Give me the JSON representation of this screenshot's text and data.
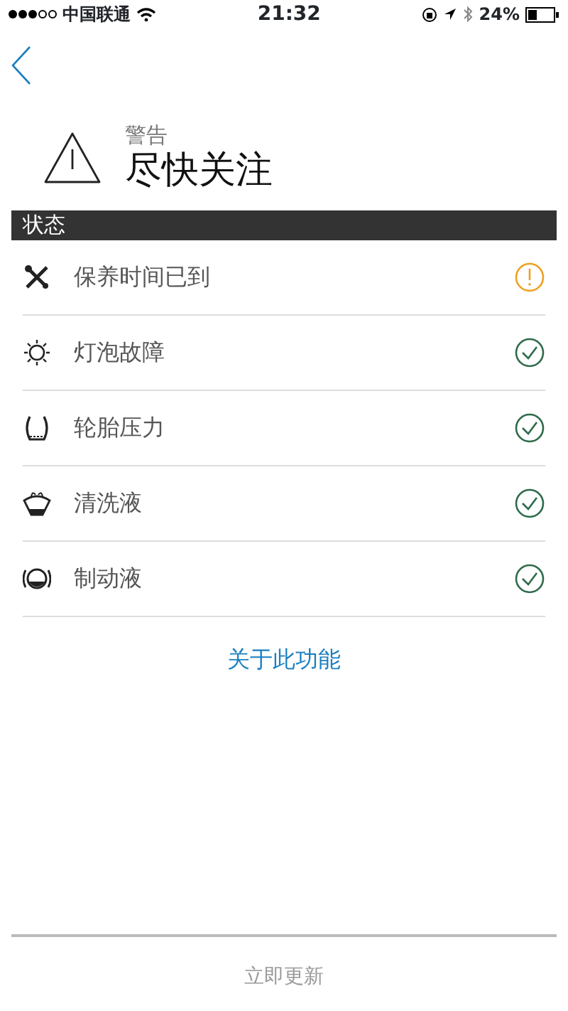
{
  "status_bar": {
    "carrier": "中国联通",
    "time": "21:32",
    "battery": "24%"
  },
  "header": {
    "label": "警告",
    "title": "尽快关注"
  },
  "section": {
    "title": "状态"
  },
  "items": [
    {
      "kind": "wrench",
      "label": "保养时间已到",
      "warning": true
    },
    {
      "kind": "bulb",
      "label": "灯泡故障",
      "warning": false
    },
    {
      "kind": "tire",
      "label": "轮胎压力",
      "warning": false
    },
    {
      "kind": "washer",
      "label": "清洗液",
      "warning": false
    },
    {
      "kind": "brake",
      "label": "制动液",
      "warning": false
    }
  ],
  "link": "关于此功能",
  "footer_button": "立即更新"
}
